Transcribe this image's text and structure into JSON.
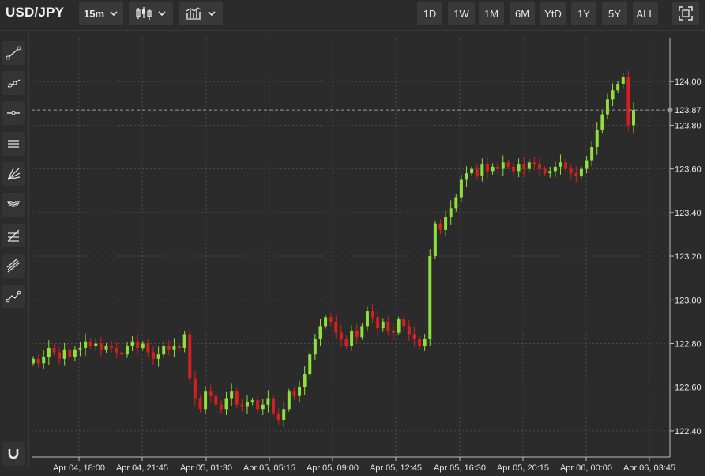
{
  "header": {
    "symbol": "USD/JPY",
    "interval": "15m",
    "chart_type_icon": "candlestick-icon",
    "indicators_icon": "indicators-icon",
    "ranges": [
      "1D",
      "1W",
      "1M",
      "6M",
      "YtD",
      "1Y",
      "5Y",
      "ALL"
    ],
    "fullscreen_icon": "fullscreen-icon"
  },
  "tools": [
    {
      "name": "trend-line-icon"
    },
    {
      "name": "ray-icon"
    },
    {
      "name": "horizontal-line-icon"
    },
    {
      "name": "parallel-channel-icon"
    },
    {
      "name": "fan-icon"
    },
    {
      "name": "arc-icon"
    },
    {
      "name": "fib-retracement-icon"
    },
    {
      "name": "pitchfork-icon"
    },
    {
      "name": "path-icon"
    },
    {
      "name": "magnet-icon"
    }
  ],
  "colors": {
    "background": "#2b2b2b",
    "up": "#8fe039",
    "down": "#d71f1f",
    "grid": "#4a4a4a",
    "text": "#e6e6e6"
  },
  "chart_data": {
    "type": "candlestick",
    "x_tick_labels": [
      "Apr 04, 18:00",
      "Apr 04, 21:45",
      "Apr 05, 01:30",
      "Apr 05, 05:15",
      "Apr 05, 09:00",
      "Apr 05, 12:45",
      "Apr 05, 16:30",
      "Apr 05, 20:15",
      "Apr 06, 00:00",
      "Apr 06, 03:45"
    ],
    "y_tick_labels": [
      "124.00",
      "123.80",
      "123.60",
      "123.40",
      "123.20",
      "123.00",
      "122.80",
      "122.60",
      "122.40"
    ],
    "y_ticks": [
      124.0,
      123.8,
      123.6,
      123.4,
      123.2,
      123.0,
      122.8,
      122.6,
      122.4
    ],
    "ylim": [
      122.28,
      124.2
    ],
    "current_price": 123.87,
    "current_price_label": "123.87",
    "grid": true,
    "approximate_closes": [
      122.73,
      122.71,
      122.74,
      122.78,
      122.76,
      122.73,
      122.77,
      122.74,
      122.77,
      122.78,
      122.81,
      122.79,
      122.8,
      122.77,
      122.79,
      122.78,
      122.76,
      122.75,
      122.79,
      122.81,
      122.78,
      122.8,
      122.76,
      122.73,
      122.75,
      122.79,
      122.77,
      122.79,
      122.78,
      122.84,
      122.64,
      122.55,
      122.5,
      122.58,
      122.56,
      122.52,
      122.5,
      122.55,
      122.58,
      122.52,
      122.51,
      122.53,
      122.54,
      122.5,
      122.52,
      122.55,
      122.48,
      122.45,
      122.5,
      122.58,
      122.56,
      122.6,
      122.66,
      122.75,
      122.82,
      122.88,
      122.92,
      122.9,
      122.85,
      122.82,
      122.79,
      122.86,
      122.83,
      122.88,
      122.95,
      122.92,
      122.87,
      122.9,
      122.86,
      122.85,
      122.91,
      122.88,
      122.84,
      122.82,
      122.79,
      122.82,
      123.2,
      123.35,
      123.32,
      123.38,
      123.42,
      123.47,
      123.55,
      123.58,
      123.6,
      123.57,
      123.62,
      123.59,
      123.61,
      123.6,
      123.63,
      123.61,
      123.59,
      123.62,
      123.6,
      123.63,
      123.62,
      123.6,
      123.58,
      123.59,
      123.61,
      123.63,
      123.6,
      123.58,
      123.57,
      123.6,
      123.64,
      123.7,
      123.78,
      123.85,
      123.92,
      123.96,
      123.99,
      124.02,
      123.8,
      123.87
    ]
  }
}
